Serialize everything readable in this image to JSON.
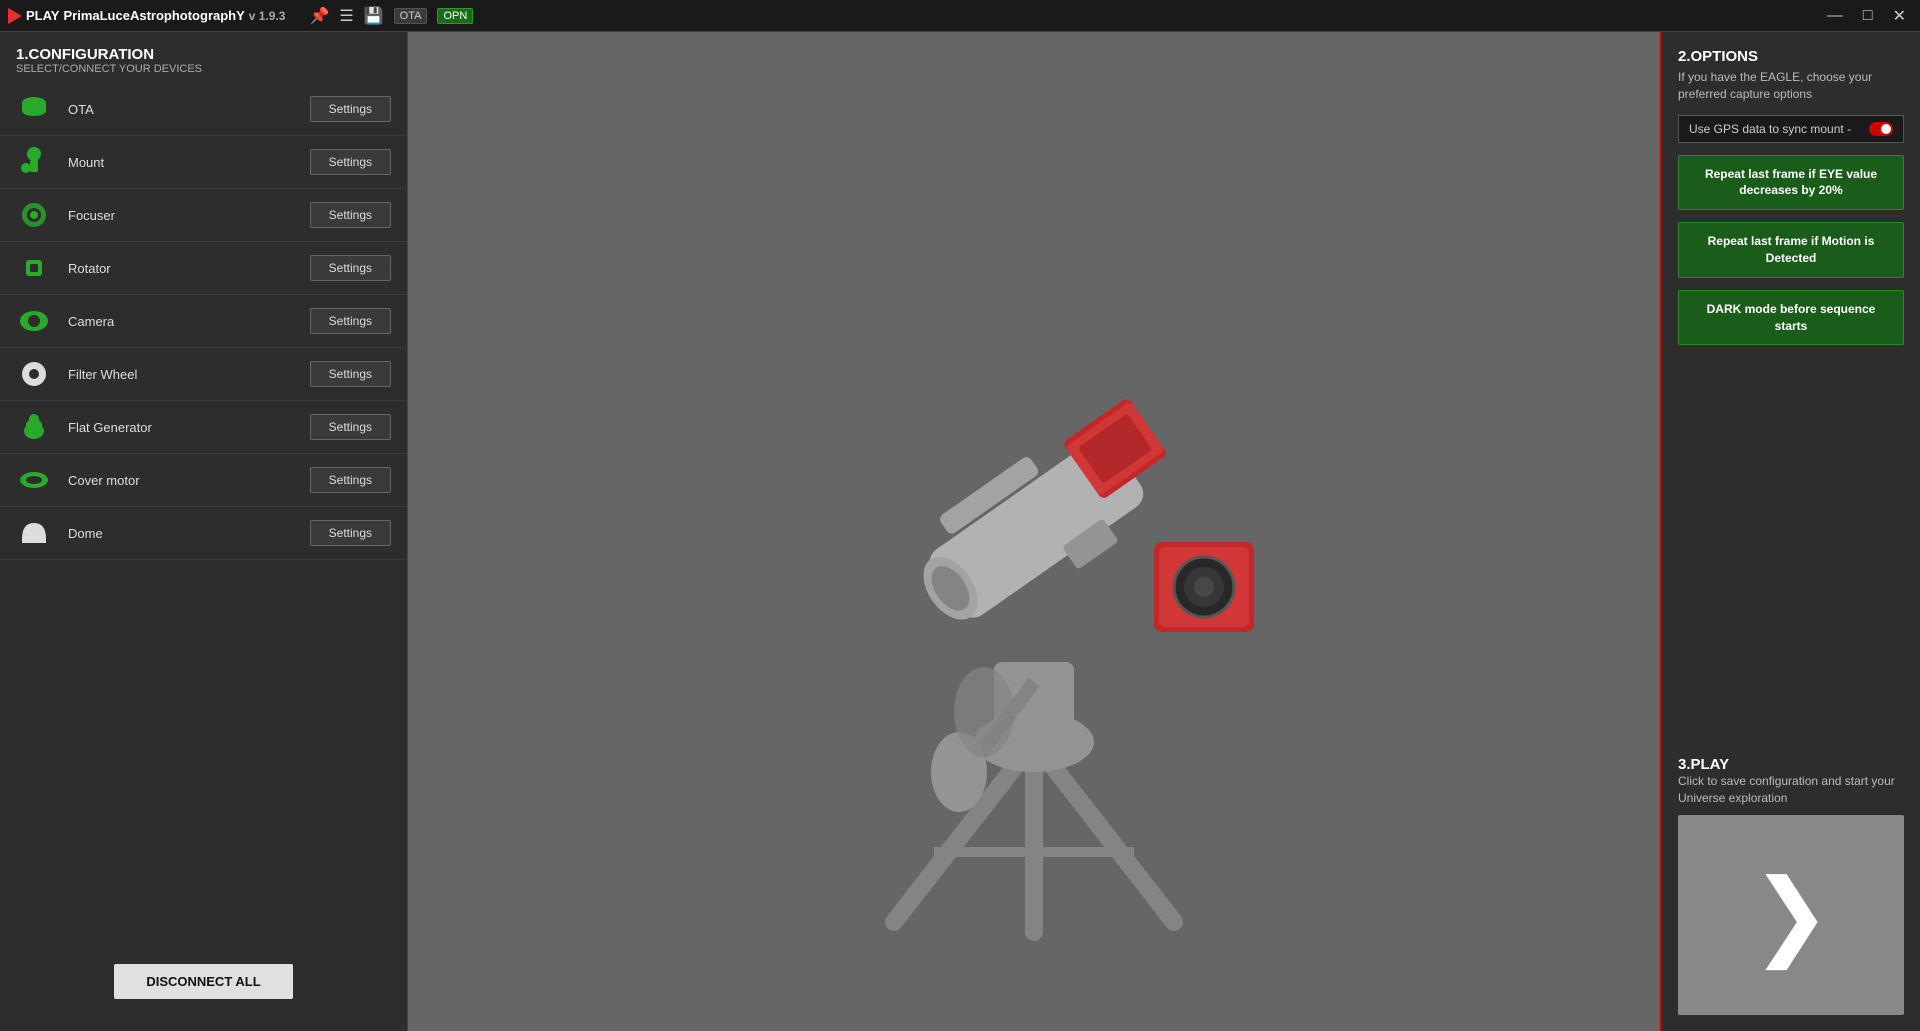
{
  "titleBar": {
    "appName": "PrimaLuceAstrophotographY",
    "prefix": "PLAY",
    "version": "v 1.9.3",
    "otaBadge": "OTA",
    "opnBadge": "OPN",
    "minimize": "—",
    "maximize": "□",
    "close": "✕"
  },
  "leftPanel": {
    "heading": "1.CONFIGURATION",
    "subheading": "SELECT/CONNECT YOUR DEVICES",
    "devices": [
      {
        "id": "ota",
        "name": "OTA",
        "icon": "ota-icon"
      },
      {
        "id": "mount",
        "name": "Mount",
        "icon": "mount-icon"
      },
      {
        "id": "focuser",
        "name": "Focuser",
        "icon": "focuser-icon"
      },
      {
        "id": "rotator",
        "name": "Rotator",
        "icon": "rotator-icon"
      },
      {
        "id": "camera",
        "name": "Camera",
        "icon": "camera-icon"
      },
      {
        "id": "filterwheel",
        "name": "Filter Wheel",
        "icon": "filterwheel-icon"
      },
      {
        "id": "flatgenerator",
        "name": "Flat Generator",
        "icon": "flatgenerator-icon"
      },
      {
        "id": "covermotor",
        "name": "Cover motor",
        "icon": "covermotor-icon"
      },
      {
        "id": "dome",
        "name": "Dome",
        "icon": "dome-icon"
      }
    ],
    "settingsLabel": "Settings",
    "disconnectAllLabel": "DISCONNECT ALL"
  },
  "rightPanel": {
    "optionsTitle": "2.OPTIONS",
    "optionsDesc": "If you have the EAGLE, choose your preferred capture options",
    "gpsLabel": "Use GPS data to sync mount -",
    "option1": "Repeat last frame if EYE value decreases by 20%",
    "option2": "Repeat last frame if Motion is Detected",
    "option3": "DARK mode before sequence starts",
    "playTitle": "3.PLAY",
    "playDesc": "Click to save configuration and start your Universe exploration"
  },
  "icons": {
    "search": "⚙",
    "filter": "≡",
    "save": "💾",
    "pin": "📌",
    "play": "❯"
  }
}
